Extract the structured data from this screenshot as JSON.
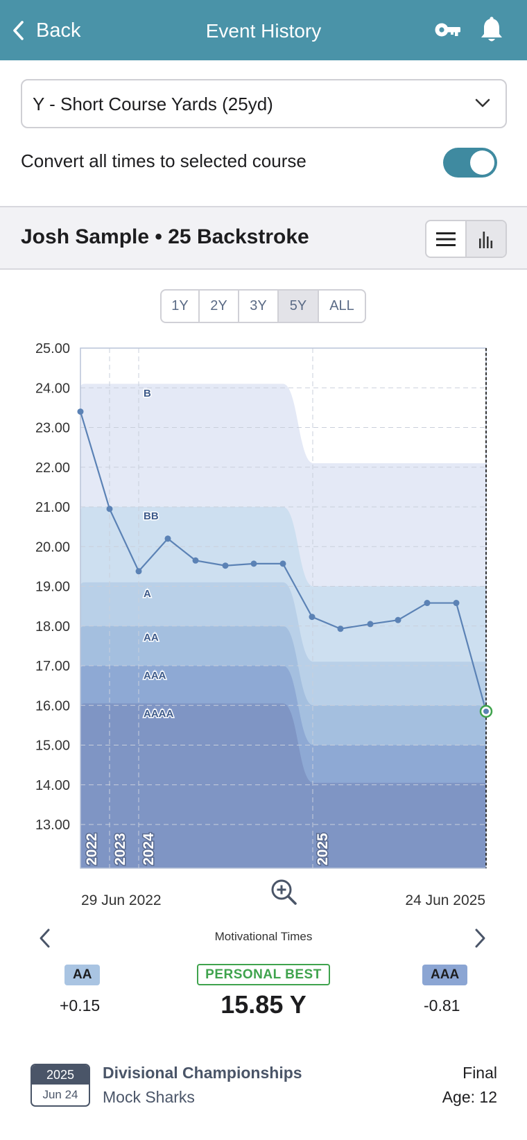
{
  "header": {
    "back_label": "Back",
    "title": "Event History",
    "back_icon": "chevron-left-icon",
    "key_icon": "key-icon",
    "bell_icon": "bell-icon",
    "bg_color": "#4a93a8"
  },
  "course": {
    "selected": "Y - Short Course Yards (25yd)",
    "convert_label": "Convert all times to selected course",
    "convert_on": true
  },
  "event": {
    "title": "Josh Sample • 25 Backstroke",
    "view_modes": [
      "list-icon",
      "bar-chart-icon"
    ],
    "selected_view": "bar-chart-icon"
  },
  "ranges": {
    "options": [
      "1Y",
      "2Y",
      "3Y",
      "5Y",
      "ALL"
    ],
    "selected": "5Y"
  },
  "chart_data": {
    "type": "line",
    "y_labels": [
      "25.00",
      "24.00",
      "23.00",
      "22.00",
      "21.00",
      "20.00",
      "19.00",
      "18.00",
      "17.00",
      "16.00",
      "15.00",
      "14.00",
      "13.00"
    ],
    "ylim": [
      11.9,
      25.0
    ],
    "y_inverted": false,
    "year_markers": [
      "2022",
      "2023",
      "2024",
      "2025"
    ],
    "x_start_label": "29 Jun 2022",
    "x_end_label": "24 Jun 2025",
    "series": [
      {
        "values": [
          23.4,
          20.95,
          19.38,
          20.2,
          19.65,
          19.52,
          19.57,
          19.57,
          18.23,
          17.93,
          18.05,
          18.15,
          18.58,
          18.58,
          15.85
        ],
        "color": "#5b82b5"
      }
    ],
    "motivational_bands": [
      {
        "name": "B",
        "before": 24.1,
        "after": 22.1,
        "color": "#e4e9f6"
      },
      {
        "name": "BB",
        "before": 21.0,
        "after": 19.0,
        "color": "#cddff0"
      },
      {
        "name": "A",
        "before": 19.1,
        "after": 17.1,
        "color": "#b9d0e8"
      },
      {
        "name": "AA",
        "before": 18.0,
        "after": 16.0,
        "color": "#a4bfdf"
      },
      {
        "name": "AAA",
        "before": 17.0,
        "after": 15.0,
        "color": "#8ea9d4"
      },
      {
        "name": "AAAA",
        "before": 16.05,
        "after": 14.05,
        "color": "#7f95c4"
      }
    ],
    "current_point_color": "#3fa34d"
  },
  "motivational": {
    "title": "Motivational Times",
    "left_standard": "AA",
    "left_diff": "+0.15",
    "right_standard": "AAA",
    "right_diff": "-0.81",
    "pb_label": "PERSONAL BEST",
    "pb_time": "15.85 Y"
  },
  "meet": {
    "year": "2025",
    "date": "Jun 24",
    "name": "Divisional Championships",
    "team": "Mock Sharks",
    "round": "Final",
    "age": "Age: 12"
  }
}
